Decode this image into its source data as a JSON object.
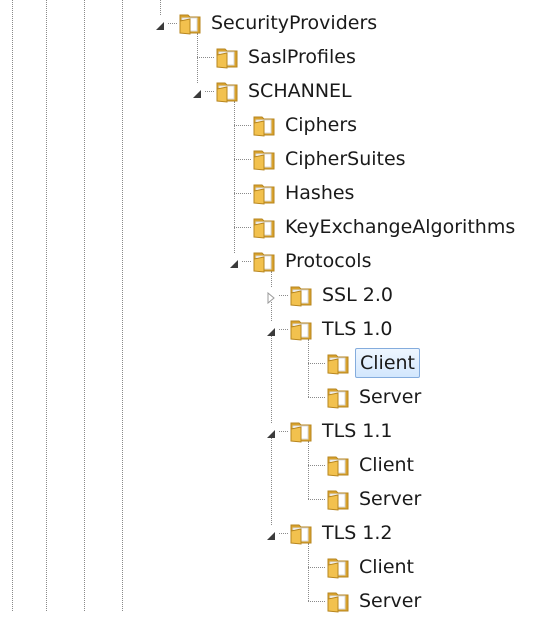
{
  "tree": {
    "nodes": [
      {
        "label": "SecurityProviders",
        "depth": 0,
        "state": "expanded",
        "selected": false
      },
      {
        "label": "SaslProfiles",
        "depth": 1,
        "state": "leaf",
        "selected": false
      },
      {
        "label": "SCHANNEL",
        "depth": 1,
        "state": "expanded",
        "selected": false
      },
      {
        "label": "Ciphers",
        "depth": 2,
        "state": "leaf",
        "selected": false
      },
      {
        "label": "CipherSuites",
        "depth": 2,
        "state": "leaf",
        "selected": false
      },
      {
        "label": "Hashes",
        "depth": 2,
        "state": "leaf",
        "selected": false
      },
      {
        "label": "KeyExchangeAlgorithms",
        "depth": 2,
        "state": "leaf",
        "selected": false
      },
      {
        "label": "Protocols",
        "depth": 2,
        "state": "expanded",
        "selected": false
      },
      {
        "label": "SSL 2.0",
        "depth": 3,
        "state": "collapsed",
        "selected": false
      },
      {
        "label": "TLS 1.0",
        "depth": 3,
        "state": "expanded",
        "selected": false
      },
      {
        "label": "Client",
        "depth": 4,
        "state": "leaf",
        "selected": true
      },
      {
        "label": "Server",
        "depth": 4,
        "state": "leaf",
        "selected": false
      },
      {
        "label": "TLS 1.1",
        "depth": 3,
        "state": "expanded",
        "selected": false
      },
      {
        "label": "Client",
        "depth": 4,
        "state": "leaf",
        "selected": false
      },
      {
        "label": "Server",
        "depth": 4,
        "state": "leaf",
        "selected": false
      },
      {
        "label": "TLS 1.2",
        "depth": 3,
        "state": "expanded",
        "selected": false
      },
      {
        "label": "Client",
        "depth": 4,
        "state": "leaf",
        "selected": false
      },
      {
        "label": "Server",
        "depth": 4,
        "state": "leaf",
        "selected": false
      }
    ]
  },
  "colors": {
    "folder_front": "#f2c14e",
    "folder_back": "#d9a22c",
    "folder_paper": "#ffffff",
    "selection_border": "#84acdd",
    "tree_line": "#8a8a8a",
    "text": "#1a1a1a"
  },
  "icons": {
    "folder": "folder-icon",
    "expanded": "expanded-triangle-icon",
    "collapsed": "collapsed-triangle-icon"
  }
}
